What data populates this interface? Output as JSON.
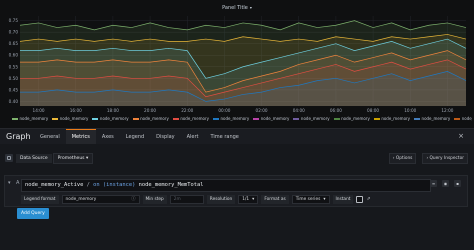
{
  "panel": {
    "title": "Panel Title",
    "y_ticks": [
      "0.75",
      "0.70",
      "0.65",
      "0.60",
      "0.55",
      "0.50",
      "0.45",
      "0.40"
    ],
    "x_ticks": [
      "14:00",
      "16:00",
      "18:00",
      "20:00",
      "22:00",
      "00:00",
      "02:00",
      "04:00",
      "06:00",
      "08:00",
      "10:00",
      "12:00"
    ],
    "legend": [
      "node_memory",
      "node_memory",
      "node_memory",
      "node_memory",
      "node_memory",
      "node_memory",
      "node_memory",
      "node_memory",
      "node_memory",
      "node_memory",
      "node_memory",
      "node_memory",
      "node_memory",
      "node_memory",
      "node_memory"
    ],
    "legend_colors": [
      "#7eb26d",
      "#eab839",
      "#6ed0e0",
      "#ef843c",
      "#e24d42",
      "#1f78c1",
      "#ba43a9",
      "#705da0",
      "#508642",
      "#cca300",
      "#447ebc",
      "#c15c17",
      "#890f02",
      "#0a437c",
      "#6d1f62"
    ]
  },
  "chart_data": {
    "type": "area",
    "x": [
      "13:00",
      "14:00",
      "15:00",
      "16:00",
      "17:00",
      "18:00",
      "19:00",
      "20:00",
      "21:00",
      "22:00",
      "23:00",
      "00:00",
      "01:00",
      "02:00",
      "03:00",
      "04:00",
      "05:00",
      "06:00",
      "07:00",
      "08:00",
      "09:00",
      "10:00",
      "11:00",
      "12:00",
      "13:00"
    ],
    "ylim": [
      0.38,
      0.77
    ],
    "series": [
      {
        "values": [
          0.73,
          0.74,
          0.72,
          0.73,
          0.71,
          0.73,
          0.72,
          0.74,
          0.72,
          0.71,
          0.73,
          0.72,
          0.74,
          0.73,
          0.71,
          0.74,
          0.72,
          0.73,
          0.75,
          0.72,
          0.74,
          0.71,
          0.73,
          0.74,
          0.72
        ]
      },
      {
        "values": [
          0.66,
          0.67,
          0.66,
          0.67,
          0.66,
          0.67,
          0.66,
          0.67,
          0.66,
          0.66,
          0.67,
          0.66,
          0.68,
          0.67,
          0.66,
          0.67,
          0.66,
          0.68,
          0.67,
          0.66,
          0.68,
          0.67,
          0.68,
          0.69,
          0.67
        ]
      },
      {
        "values": [
          0.62,
          0.62,
          0.63,
          0.62,
          0.62,
          0.63,
          0.62,
          0.62,
          0.63,
          0.62,
          0.5,
          0.52,
          0.55,
          0.57,
          0.59,
          0.61,
          0.63,
          0.65,
          0.62,
          0.64,
          0.66,
          0.63,
          0.65,
          0.67,
          0.63
        ]
      },
      {
        "values": [
          0.57,
          0.57,
          0.58,
          0.57,
          0.57,
          0.58,
          0.57,
          0.57,
          0.58,
          0.57,
          0.44,
          0.46,
          0.49,
          0.51,
          0.53,
          0.56,
          0.58,
          0.6,
          0.57,
          0.59,
          0.61,
          0.58,
          0.6,
          0.62,
          0.58
        ]
      },
      {
        "values": [
          0.5,
          0.5,
          0.51,
          0.5,
          0.5,
          0.51,
          0.5,
          0.5,
          0.51,
          0.5,
          0.42,
          0.44,
          0.46,
          0.48,
          0.5,
          0.52,
          0.54,
          0.56,
          0.53,
          0.55,
          0.57,
          0.54,
          0.56,
          0.58,
          0.54
        ]
      },
      {
        "values": [
          0.44,
          0.44,
          0.45,
          0.44,
          0.44,
          0.45,
          0.44,
          0.44,
          0.45,
          0.44,
          0.4,
          0.41,
          0.43,
          0.44,
          0.46,
          0.47,
          0.49,
          0.5,
          0.48,
          0.5,
          0.52,
          0.49,
          0.51,
          0.53,
          0.49
        ]
      }
    ]
  },
  "edit": {
    "title": "Graph",
    "tabs": [
      "General",
      "Metrics",
      "Axes",
      "Legend",
      "Display",
      "Alert",
      "Time range"
    ],
    "active_tab": "Metrics",
    "close": "×"
  },
  "metrics": {
    "datasource_label": "Data Source",
    "datasource_value": "Prometheus",
    "options_label": "Options",
    "inspector_label": "Query Inspector",
    "query": {
      "letter": "A",
      "expr_metric": "node_memory_Active",
      "expr_op": "/",
      "expr_by": "on (instance)",
      "expr_metric2": "node_memory_MemTotal",
      "legend_format_label": "Legend format",
      "legend_format_value": "node_memory",
      "min_step_label": "Min step",
      "min_step_placeholder": "2m",
      "resolution_label": "Resolution",
      "resolution_value": "1/1",
      "format_as_label": "Format as",
      "format_as_value": "Time series",
      "instant_label": "Instant"
    },
    "add_query_label": "Add Query"
  }
}
